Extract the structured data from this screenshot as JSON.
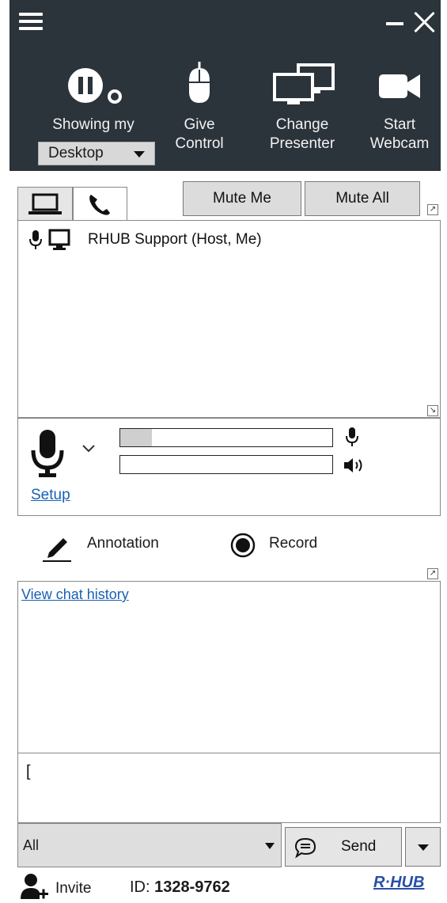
{
  "toolbar": {
    "showing_label": "Showing my",
    "desktop_option": "Desktop",
    "give_line1": "Give",
    "give_line2": "Control",
    "change_line1": "Change",
    "change_line2": "Presenter",
    "webcam_line1": "Start",
    "webcam_line2": "Webcam"
  },
  "participants": {
    "mute_me_label": "Mute Me",
    "mute_all_label": "Mute All",
    "list": [
      {
        "name": "RHUB Support (Host, Me)"
      }
    ]
  },
  "audio": {
    "mic_level": 0.15,
    "speaker_level": 0.0,
    "setup_label": "Setup"
  },
  "tools": {
    "annotation_label": "Annotation",
    "record_label": "Record"
  },
  "chat": {
    "history_link": "View chat history",
    "input_value": "[",
    "recipient": "All",
    "send_label": "Send"
  },
  "footer": {
    "invite_label": "Invite",
    "id_prefix": "ID:",
    "meeting_id": "1328-9762",
    "brand": "R·HUB"
  },
  "colors": {
    "toolbar_bg": "#2b333b",
    "link": "#1a5fb4",
    "brand": "#2a4fa8"
  }
}
